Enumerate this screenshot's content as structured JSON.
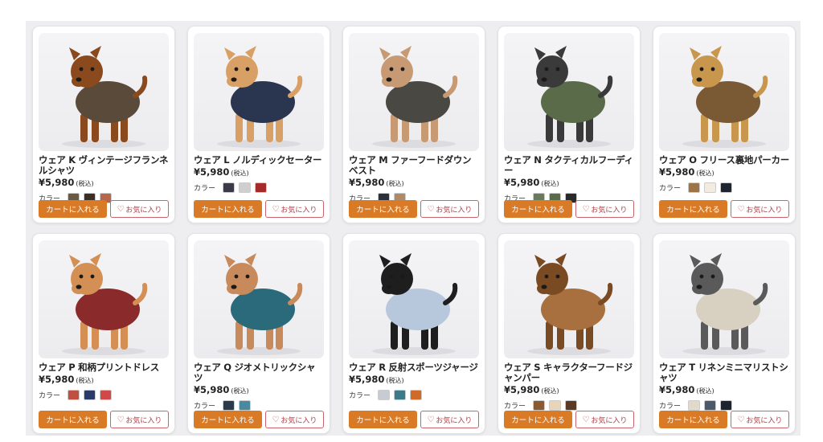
{
  "color_label": "カラー",
  "cart_label": "カートに入れる",
  "fav_label": "お気に入り",
  "tax_label": "(税込)",
  "products": [
    {
      "name": "ウェア K ヴィンテージフランネルシャツ",
      "price": "¥5,980",
      "coat": "#5a4a3a",
      "fur": "#8b4a1e",
      "swatches": [
        "#6d5840",
        "#3c2e22",
        "#b8664a"
      ]
    },
    {
      "name": "ウェア L ノルディックセーター",
      "price": "¥5,980",
      "coat": "#2a3550",
      "fur": "#d9a066",
      "swatches": [
        "#3a3a48",
        "#cfcfcf",
        "#a52a2a"
      ]
    },
    {
      "name": "ウェア M ファーフードダウンベスト",
      "price": "¥5,980",
      "coat": "#4a4842",
      "fur": "#c89a74",
      "swatches": [
        "#2c3038",
        "#b08a66"
      ]
    },
    {
      "name": "ウェア N タクティカルフーディー",
      "price": "¥5,980",
      "coat": "#5a6b4a",
      "fur": "#3a3a3a",
      "swatches": [
        "#6c7a5c",
        "#5a6b4a",
        "#2a2a2a"
      ]
    },
    {
      "name": "ウェア O フリース裏地パーカー",
      "price": "¥5,980",
      "coat": "#7a5a34",
      "fur": "#c8964c",
      "swatches": [
        "#9c7446",
        "#f2ece0",
        "#1e2430"
      ]
    },
    {
      "name": "ウェア P 和柄プリントドレス",
      "price": "¥5,980",
      "coat": "#8a2a2a",
      "fur": "#d49054",
      "swatches": [
        "#c05040",
        "#2a3a6a",
        "#d04848"
      ]
    },
    {
      "name": "ウェア Q ジオメトリックシャツ",
      "price": "¥5,980",
      "coat": "#2a6a7a",
      "fur": "#c88a5a",
      "swatches": [
        "#2a3a4a",
        "#4a8aa0"
      ]
    },
    {
      "name": "ウェア R 反射スポーツジャージ",
      "price": "¥5,980",
      "coat": "#b8c8dc",
      "fur": "#1e1e1e",
      "swatches": [
        "#c8ccd2",
        "#3a7a8a",
        "#d06a2a"
      ]
    },
    {
      "name": "ウェア S キャラクターフードジャンパー",
      "price": "¥5,980",
      "coat": "#a8703e",
      "fur": "#7a4a22",
      "swatches": [
        "#8a5a32",
        "#e8d4b8",
        "#5a3a22"
      ]
    },
    {
      "name": "ウェア T リネンミニマリストシャツ",
      "price": "¥5,980",
      "coat": "#d8d0c0",
      "fur": "#5a5a5a",
      "swatches": [
        "#e2dac8",
        "#4a5a6a",
        "#1e2430"
      ]
    }
  ]
}
